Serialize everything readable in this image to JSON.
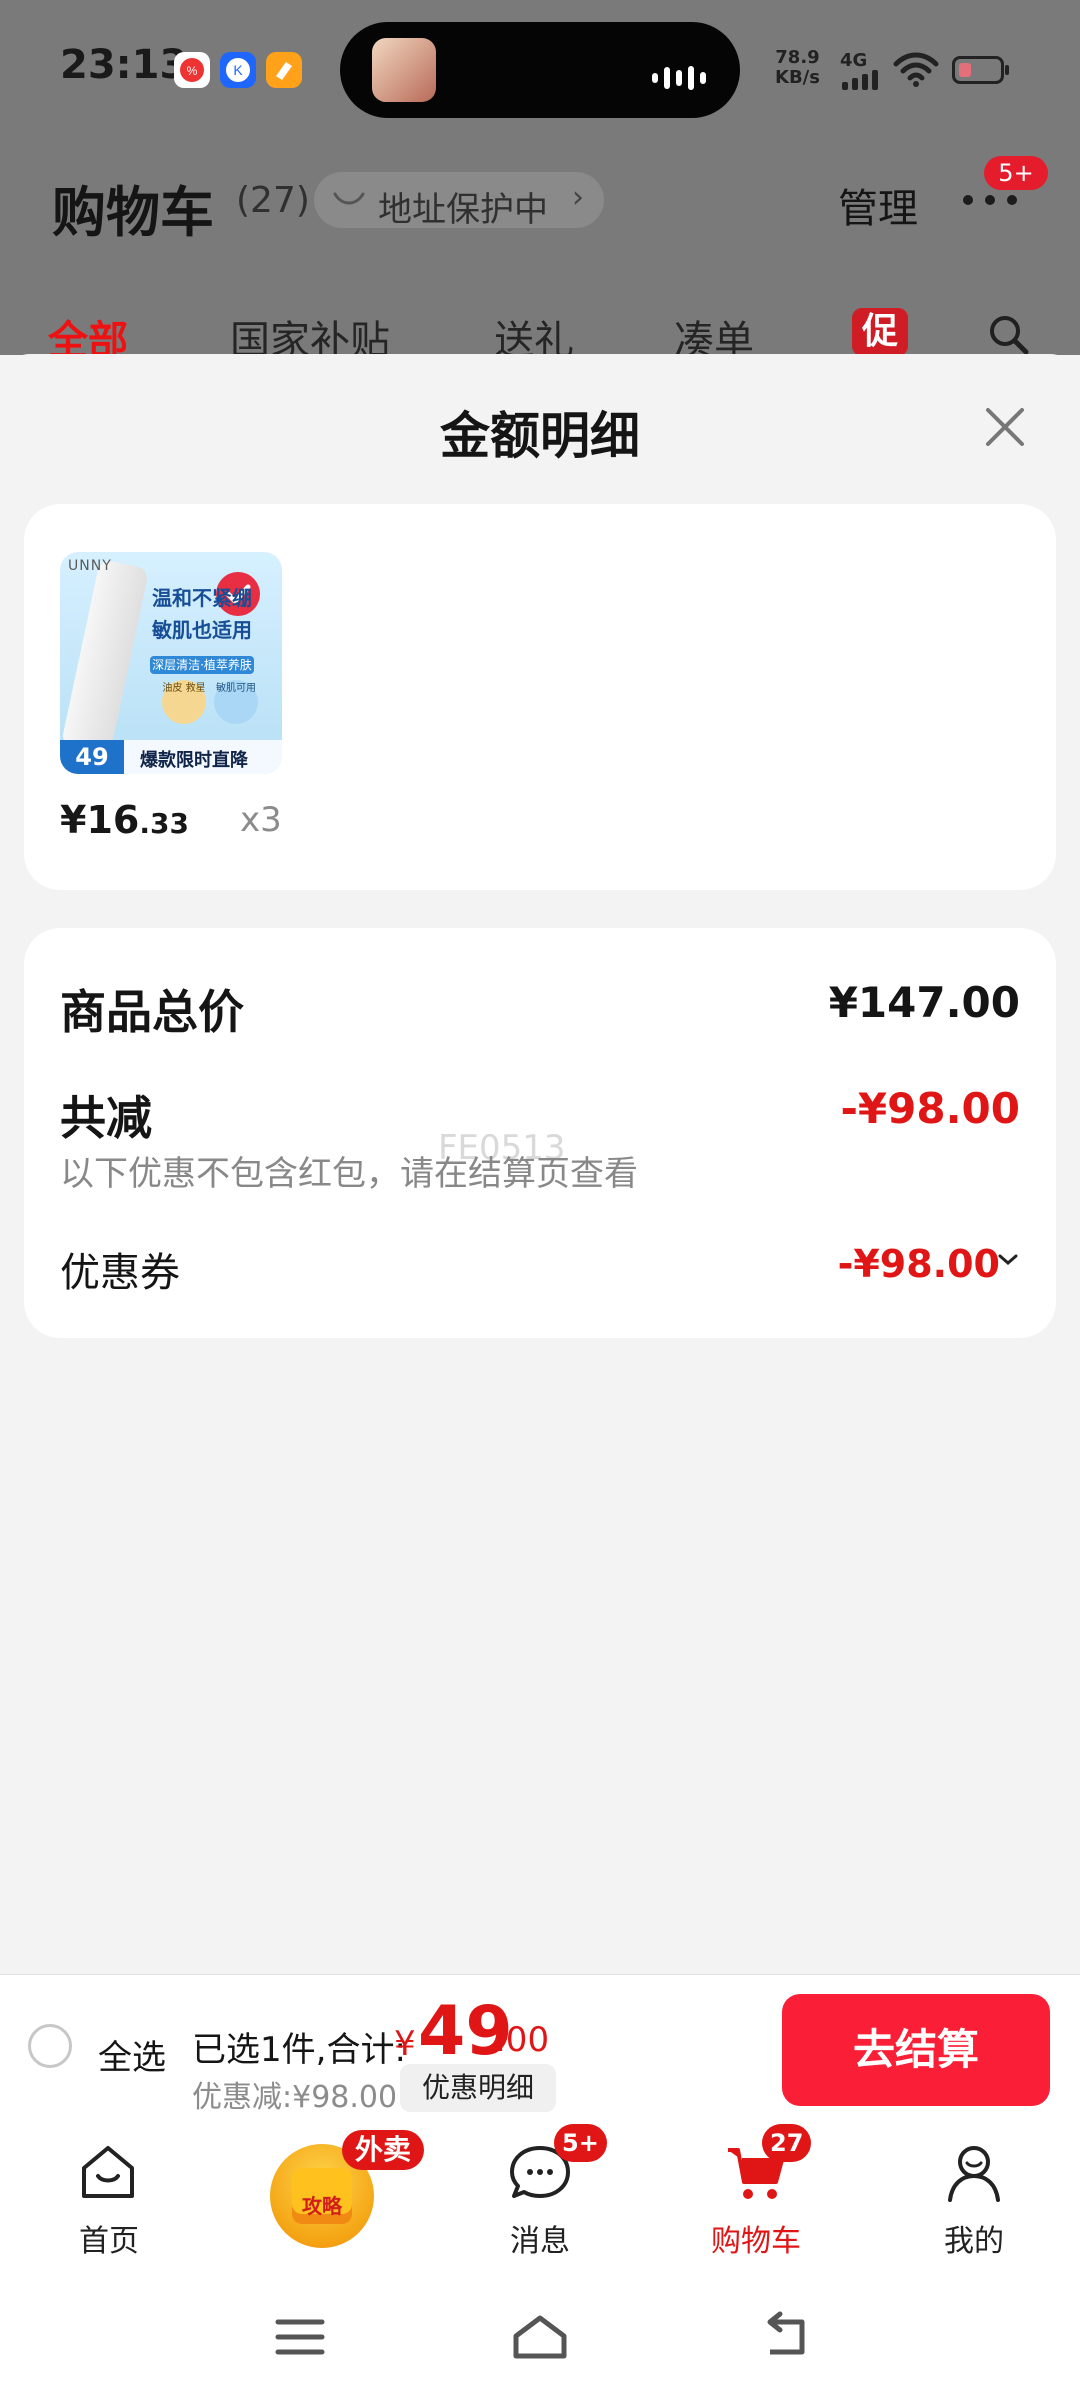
{
  "status_bar": {
    "time": "23:13",
    "net_speed_value": "78.9",
    "net_speed_unit": "KB/s",
    "network": "4G",
    "app_icons": [
      "chat-app-icon",
      "k-app-icon",
      "orange-app-icon"
    ],
    "island_app": "music-thumbnail-icon"
  },
  "header": {
    "title": "购物车",
    "count": "(27)",
    "address": "地址保护中",
    "manage": "管理",
    "more_badge": "5+",
    "tabs": [
      "全部",
      "国家补贴",
      "送礼",
      "凑单"
    ],
    "promo_tab": "促"
  },
  "sheet": {
    "title": "金额明细",
    "product": {
      "price_main": "¥16",
      "price_decimal": ".33",
      "quantity": "x3",
      "image_text": {
        "brand": "UNNY",
        "line1": "温和不紧绷",
        "line2": "敏肌也适用",
        "subline": "深层清洁·植萃养肤",
        "badge1": "油皮\n救星",
        "badge2": "敏肌可用",
        "price_badge": "49",
        "caption": "爆款限时直降"
      }
    },
    "summary": {
      "total_label": "商品总价",
      "total_value": "¥147.00",
      "reduction_label": "共减",
      "reduction_value": "-¥98.00",
      "note": "以下优惠不包含红包，请在结算页查看",
      "coupon_label": "优惠券",
      "coupon_value": "-¥98.00",
      "watermark": "FE0513"
    }
  },
  "checkout": {
    "select_all": "全选",
    "selected_text": "已选1件,合计:",
    "currency": "¥",
    "total_int": "49",
    "total_dec": ".00",
    "discount": "优惠减:¥98.00",
    "detail_button": "优惠明细",
    "checkout_button": "去结算"
  },
  "bottom_nav": {
    "items": [
      {
        "label": "首页",
        "icon": "home-icon"
      },
      {
        "label": "攻略",
        "icon": "takeaway-box-icon",
        "badge": "外卖"
      },
      {
        "label": "消息",
        "icon": "message-icon",
        "badge": "5+"
      },
      {
        "label": "购物车",
        "icon": "cart-icon",
        "badge": "27",
        "active": true
      },
      {
        "label": "我的",
        "icon": "profile-icon"
      }
    ]
  },
  "system_nav": {
    "icons": [
      "menu-icon",
      "home-outline-icon",
      "back-icon"
    ]
  },
  "colors": {
    "accent": "#e01616",
    "checkout": "#fa1e36",
    "background": "#f3f3f3"
  }
}
